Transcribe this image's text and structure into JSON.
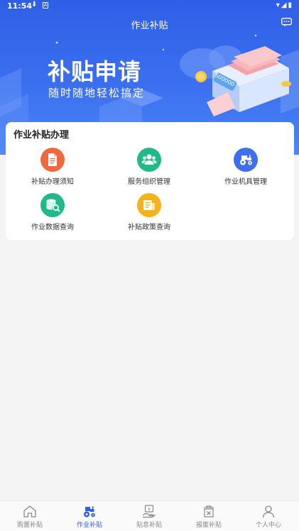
{
  "status_bar": {
    "time": "11:54",
    "download_glyph": "⬇",
    "a_glyph": "A",
    "right_glyphs": "▾◢▮"
  },
  "header": {
    "title": "作业补贴"
  },
  "banner": {
    "title": "补贴申请",
    "subtitle": "随时随地轻松搞定",
    "money_label": "500000"
  },
  "card": {
    "title": "作业补贴办理",
    "items": [
      {
        "label": "补贴办理须知",
        "icon": "document-icon",
        "color": "#f0683d"
      },
      {
        "label": "服务组织管理",
        "icon": "people-icon",
        "color": "#1fb98a"
      },
      {
        "label": "作业机具管理",
        "icon": "tractor-icon",
        "color": "#3f6ff0"
      },
      {
        "label": "作业数据查询",
        "icon": "database-search-icon",
        "color": "#1fb98a"
      },
      {
        "label": "补贴政策查询",
        "icon": "policy-doc-icon",
        "color": "#f5b21a"
      }
    ]
  },
  "nav": {
    "items": [
      {
        "label": "购置补贴",
        "icon": "home-icon",
        "active": false
      },
      {
        "label": "作业补贴",
        "icon": "tractor-icon",
        "active": true
      },
      {
        "label": "贴息补贴",
        "icon": "interest-hand-icon",
        "active": false
      },
      {
        "label": "报废补贴",
        "icon": "scrap-box-icon",
        "active": false
      },
      {
        "label": "个人中心",
        "icon": "user-icon",
        "active": false
      }
    ]
  },
  "colors": {
    "primary": "#2f5fe6",
    "background": "#f4f4f4"
  }
}
